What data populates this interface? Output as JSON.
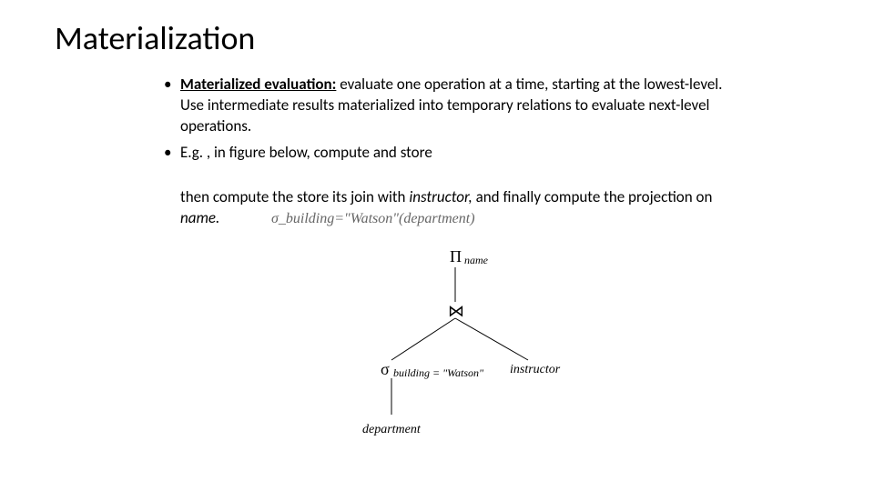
{
  "title": "Materialization",
  "bullets": {
    "b1_lead": "Materialized evaluation:",
    "b1_rest": "  evaluate one operation at a time, starting at the lowest-level.  Use intermediate results materialized into temporary relations to evaluate next-level operations.",
    "b2": "E.g. , in figure below, compute and store"
  },
  "formula_inline": "σ_building=\"Watson\"(department)",
  "continuation_a": "then compute the store its join with ",
  "continuation_b": "instructor,",
  "continuation_c": " and finally compute the projection on ",
  "continuation_d": "name.",
  "tree": {
    "top_op": "Π",
    "top_sub": "name",
    "join_op": "⋈",
    "left_op": "σ",
    "left_sub": "building = \"Watson\"",
    "left_leaf": "department",
    "right_leaf": "instructor"
  }
}
